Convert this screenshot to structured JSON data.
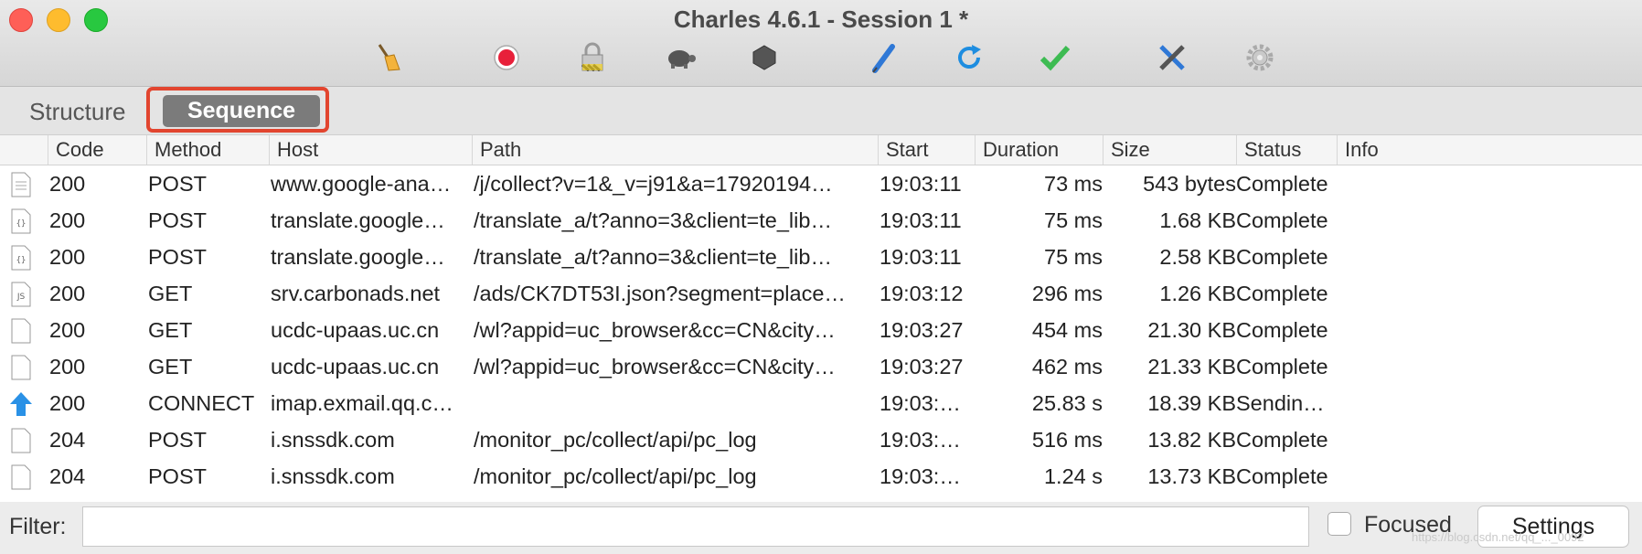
{
  "window": {
    "title": "Charles 4.6.1 - Session 1 *"
  },
  "toolbar": {
    "icons": [
      "broom-icon",
      "record-icon",
      "ssl-lock-icon",
      "throttle-turtle-icon",
      "stop-hexagon-icon",
      "compose-pen-icon",
      "repeat-icon",
      "validate-check-icon",
      "tools-icon",
      "settings-gear-icon"
    ]
  },
  "tabs": {
    "structure": "Structure",
    "sequence": "Sequence",
    "active": "sequence"
  },
  "columns": [
    "Code",
    "Method",
    "Host",
    "Path",
    "Start",
    "Duration",
    "Size",
    "Status",
    "Info"
  ],
  "rows": [
    {
      "icon": "document-icon",
      "code": "200",
      "method": "POST",
      "host": "www.google-ana…",
      "path": "/j/collect?v=1&_v=j91&a=17920194…",
      "start": "19:03:11",
      "duration": "73 ms",
      "size": "543 bytes",
      "status": "Complete",
      "info": ""
    },
    {
      "icon": "json-icon",
      "code": "200",
      "method": "POST",
      "host": "translate.google…",
      "path": "/translate_a/t?anno=3&client=te_lib…",
      "start": "19:03:11",
      "duration": "75 ms",
      "size": "1.68 KB",
      "status": "Complete",
      "info": ""
    },
    {
      "icon": "json-icon",
      "code": "200",
      "method": "POST",
      "host": "translate.google…",
      "path": "/translate_a/t?anno=3&client=te_lib…",
      "start": "19:03:11",
      "duration": "75 ms",
      "size": "2.58 KB",
      "status": "Complete",
      "info": ""
    },
    {
      "icon": "js-icon",
      "code": "200",
      "method": "GET",
      "host": "srv.carbonads.net",
      "path": "/ads/CK7DT53I.json?segment=place…",
      "start": "19:03:12",
      "duration": "296 ms",
      "size": "1.26 KB",
      "status": "Complete",
      "info": ""
    },
    {
      "icon": "blank-file-icon",
      "code": "200",
      "method": "GET",
      "host": "ucdc-upaas.uc.cn",
      "path": "/wl?appid=uc_browser&cc=CN&city…",
      "start": "19:03:27",
      "duration": "454 ms",
      "size": "21.30 KB",
      "status": "Complete",
      "info": ""
    },
    {
      "icon": "blank-file-icon",
      "code": "200",
      "method": "GET",
      "host": "ucdc-upaas.uc.cn",
      "path": "/wl?appid=uc_browser&cc=CN&city…",
      "start": "19:03:27",
      "duration": "462 ms",
      "size": "21.33 KB",
      "status": "Complete",
      "info": ""
    },
    {
      "icon": "upload-arrow-icon",
      "code": "200",
      "method": "CONNECT",
      "host": "imap.exmail.qq.c…",
      "path": "",
      "start": "19:03:…",
      "duration": "25.83 s",
      "size": "18.39 KB",
      "status": "Sendin…",
      "info": ""
    },
    {
      "icon": "blank-file-icon",
      "code": "204",
      "method": "POST",
      "host": "i.snssdk.com",
      "path": "/monitor_pc/collect/api/pc_log",
      "start": "19:03:…",
      "duration": "516 ms",
      "size": "13.82 KB",
      "status": "Complete",
      "info": ""
    },
    {
      "icon": "blank-file-icon",
      "code": "204",
      "method": "POST",
      "host": "i.snssdk.com",
      "path": "/monitor_pc/collect/api/pc_log",
      "start": "19:03:…",
      "duration": "1.24 s",
      "size": "13.73 KB",
      "status": "Complete",
      "info": ""
    }
  ],
  "filter": {
    "label": "Filter:",
    "value": "",
    "placeholder": ""
  },
  "focused": {
    "label": "Focused",
    "checked": false
  },
  "settings": {
    "label": "Settings"
  },
  "watermark": "https://blog.csdn.net/qq_..._0092"
}
